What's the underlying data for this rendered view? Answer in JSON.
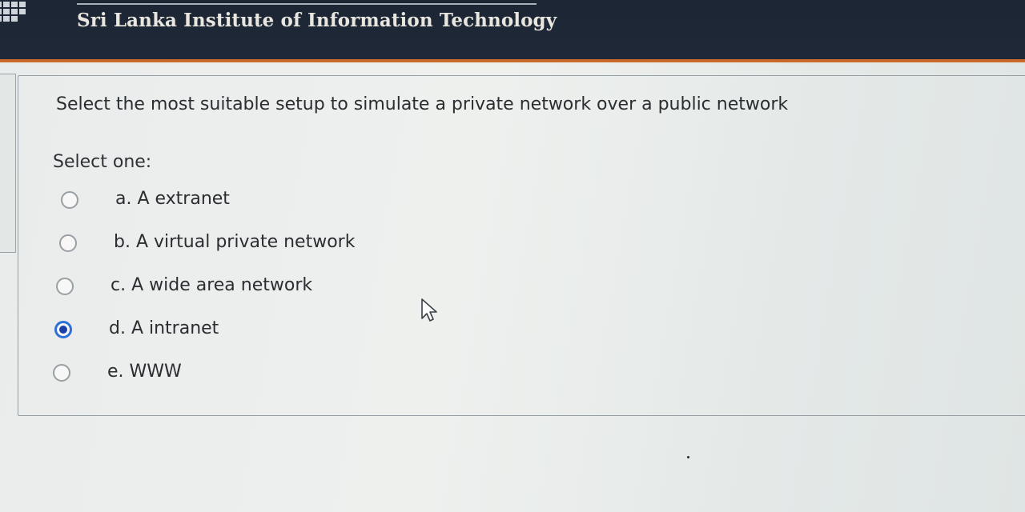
{
  "header": {
    "institute_name": "Sri Lanka Institute of Information Technology"
  },
  "question": {
    "text": "Select the most suitable setup to simulate a private network over a public network",
    "instruction": "Select one:",
    "options": [
      {
        "label": "a. A extranet",
        "selected": false
      },
      {
        "label": "b. A virtual private network",
        "selected": false
      },
      {
        "label": "c. A wide area network",
        "selected": false
      },
      {
        "label": "d. A intranet",
        "selected": true
      },
      {
        "label": "e. WWW",
        "selected": false
      }
    ]
  },
  "colors": {
    "header_bg": "#1c2634",
    "header_accent": "#c96a2a",
    "radio_selected": "#1b3fa8"
  },
  "icons": {
    "logo": "sliit-logo-icon",
    "cursor": "mouse-pointer-icon"
  }
}
